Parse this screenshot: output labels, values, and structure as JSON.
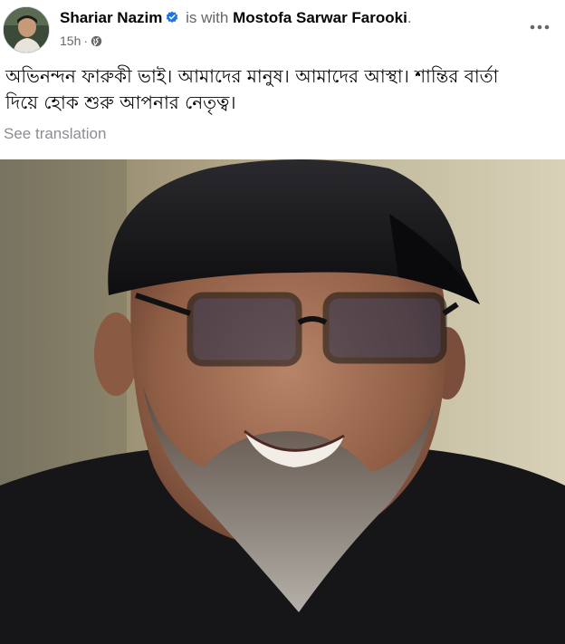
{
  "post": {
    "author": "Shariar Nazim",
    "with_text": "is with",
    "tagged": "Mostofa Sarwar Farooki",
    "tagged_suffix": ".",
    "time": "15h",
    "dot": "·",
    "audience_icon": "globe-icon",
    "more_icon": "more-options-icon",
    "text_line1": "অভিনন্দন ফারুকী ভাই। আমাদের মানুষ। আমাদের আস্থা। শান্তির বার্তা",
    "text_line2": "দিয়ে হোক শুরু আপনার নেতৃত্ব।",
    "see_translation": "See translation"
  },
  "colors": {
    "verified_blue": "#1b74e4",
    "secondary_text": "#65676b",
    "primary_text": "#050505"
  }
}
